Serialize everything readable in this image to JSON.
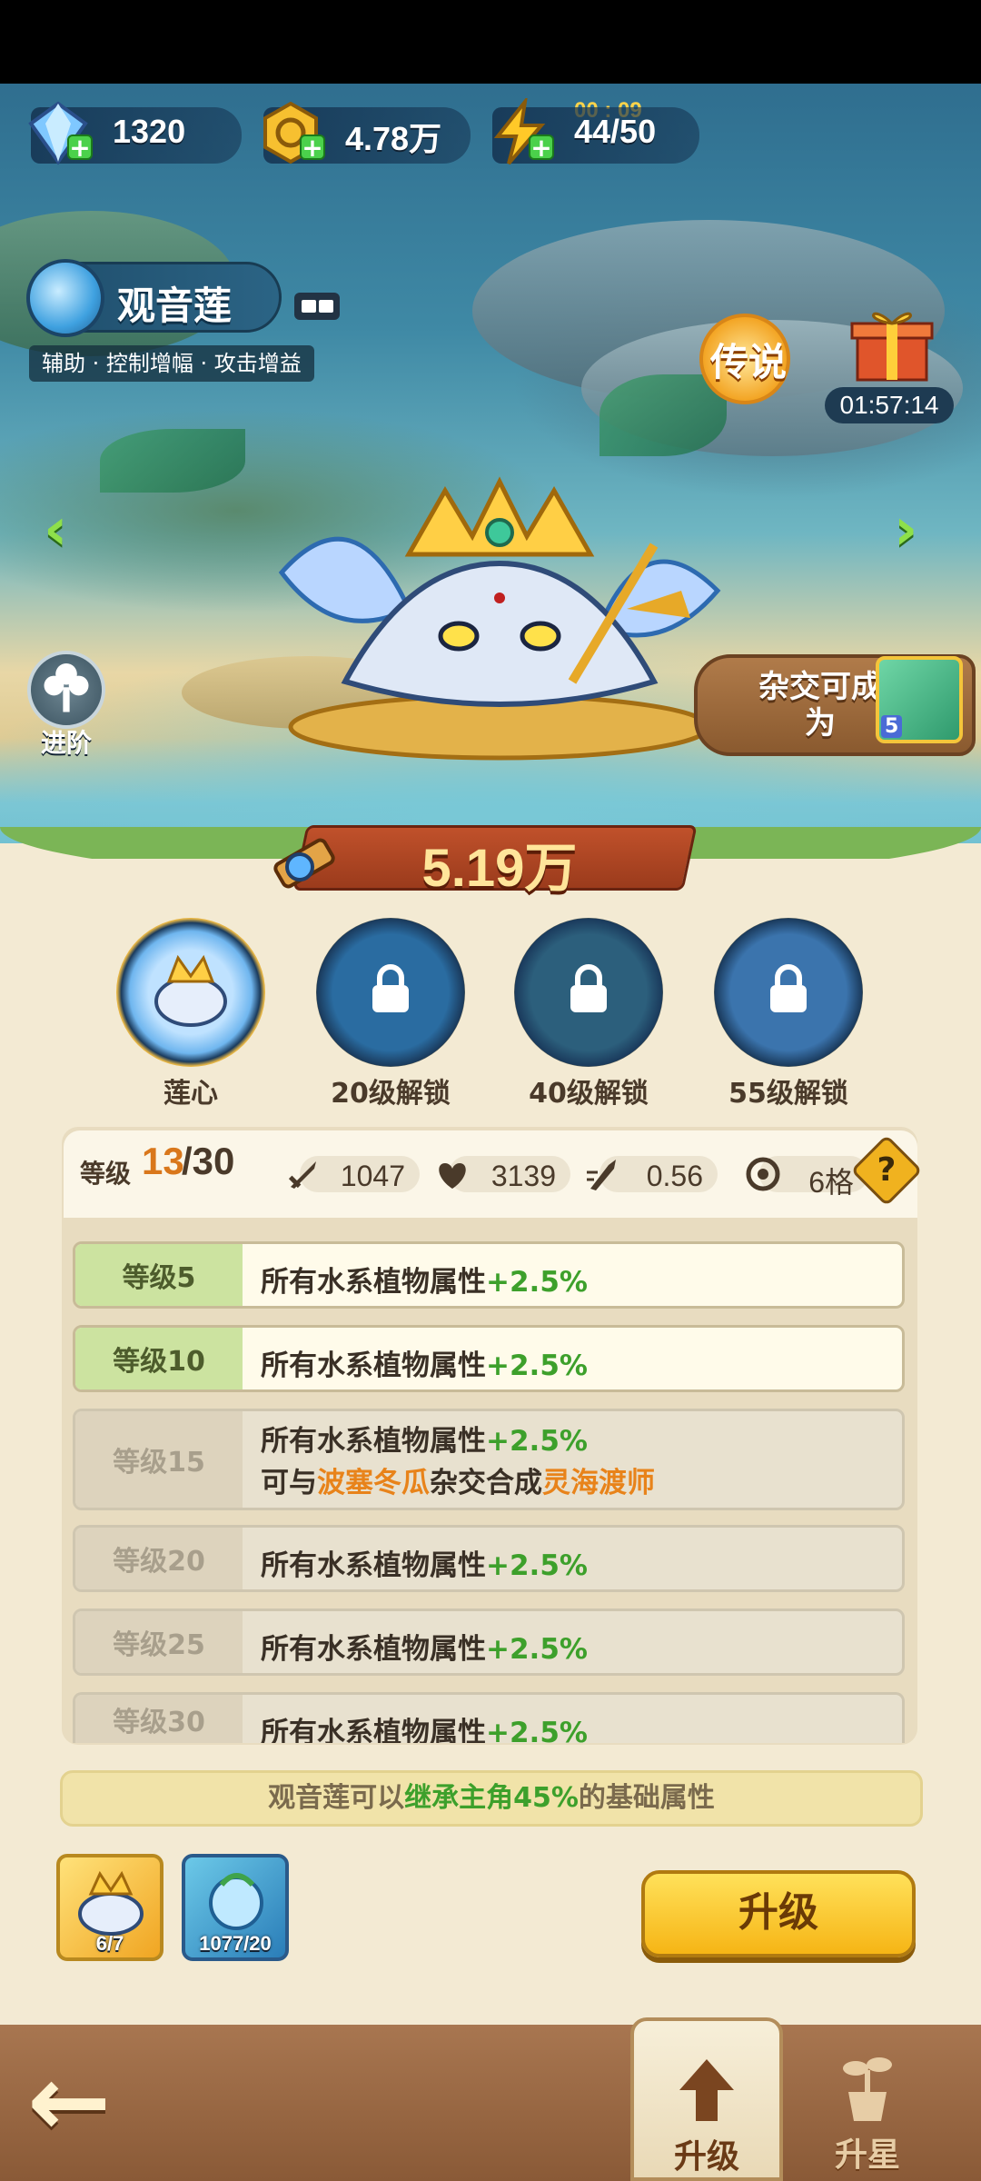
{
  "currencies": {
    "gems": "1320",
    "coins": "4.78万",
    "energy": "44/50",
    "energy_timer": "00 : 09"
  },
  "hero": {
    "name": "观音莲",
    "tags": "辅助 · 控制增幅 · 攻击增益",
    "rarity": "传说",
    "gift_timer": "01:57:14",
    "advance_label": "进阶",
    "hybrid_label": "杂交可成为",
    "hybrid_count": "5",
    "power": "5.19万"
  },
  "skills": [
    {
      "label": "莲心",
      "locked": false
    },
    {
      "label": "20级解锁",
      "locked": true
    },
    {
      "label": "40级解锁",
      "locked": true
    },
    {
      "label": "55级解锁",
      "locked": true
    }
  ],
  "stats": {
    "level_label": "等级",
    "level_current": "13",
    "level_max": "/30",
    "attack": "1047",
    "hp": "3139",
    "speed": "0.56",
    "range": "6格",
    "help": "?"
  },
  "level_rewards": [
    {
      "level": "等级5",
      "text": "所有水系植物属性",
      "bonus": "+2.5%",
      "unlocked": true
    },
    {
      "level": "等级10",
      "text": "所有水系植物属性",
      "bonus": "+2.5%",
      "unlocked": true
    },
    {
      "level": "等级15",
      "text": "所有水系植物属性",
      "bonus": "+2.5%",
      "line2_a": "可与",
      "line2_b": "波塞冬瓜",
      "line2_c": "杂交合成",
      "line2_d": "灵海渡师",
      "unlocked": false
    },
    {
      "level": "等级20",
      "text": "所有水系植物属性",
      "bonus": "+2.5%",
      "unlocked": false
    },
    {
      "level": "等级25",
      "text": "所有水系植物属性",
      "bonus": "+2.5%",
      "unlocked": false
    },
    {
      "level": "等级30",
      "text": "所有水系植物属性",
      "bonus": "+2.5%",
      "unlocked": false
    }
  ],
  "inherit": {
    "a": "观音莲可以",
    "b": "继承主角45%",
    "c": "的基础属性"
  },
  "items": [
    {
      "count": "6/7"
    },
    {
      "count": "1077/20"
    }
  ],
  "buttons": {
    "upgrade": "升级"
  },
  "nav": {
    "back": "←",
    "upgrade": "升级",
    "star": "升星"
  },
  "colors": {
    "accent_green": "#3da02b",
    "accent_orange": "#e8831a",
    "button_yellow": "#f6b515"
  }
}
